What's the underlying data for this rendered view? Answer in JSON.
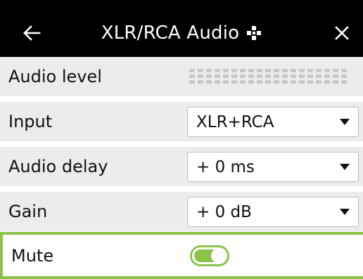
{
  "colors": {
    "header_bg": "#000000",
    "row_bg": "#ececec",
    "accent": "#8bc34a"
  },
  "header": {
    "title": "XLR/RCA Audio",
    "back_icon": "back-arrow-icon",
    "move_icon": "move-icon",
    "close_icon": "close-icon"
  },
  "rows": {
    "audio_level": {
      "label": "Audio level",
      "meter_level": 0
    },
    "input": {
      "label": "Input",
      "value": "XLR+RCA"
    },
    "audio_delay": {
      "label": "Audio delay",
      "value": "+ 0 ms"
    },
    "gain": {
      "label": "Gain",
      "value": "+ 0 dB"
    },
    "mute": {
      "label": "Mute",
      "on": true
    }
  }
}
